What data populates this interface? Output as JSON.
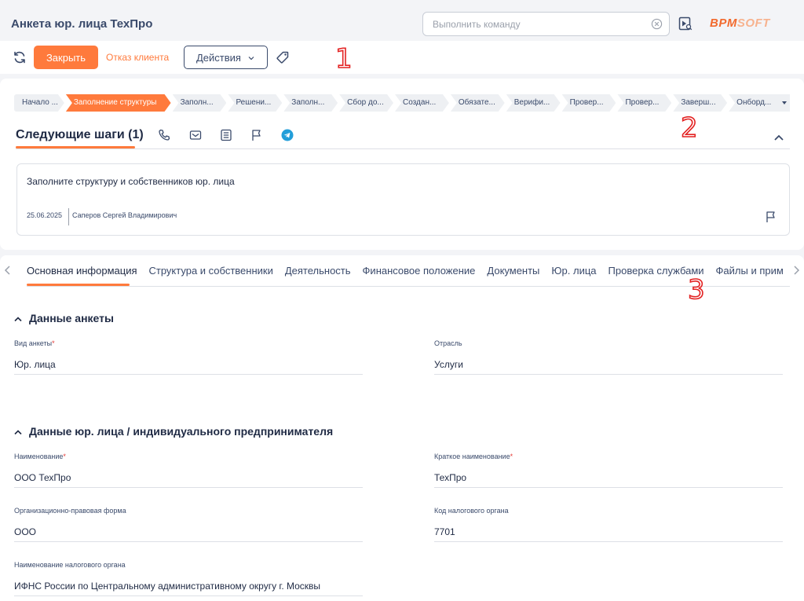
{
  "header": {
    "title": "Анкета юр. лица ТехПро",
    "command_placeholder": "Выполнить команду",
    "logo_part1": "ВРМ",
    "logo_part2": "SOFT"
  },
  "toolbar": {
    "close_label": "Закрыть",
    "reject_label": "Отказ клиента",
    "actions_label": "Действия"
  },
  "markers": [
    "1",
    "2",
    "3"
  ],
  "stages": [
    {
      "label": "Начало ...",
      "state": "done"
    },
    {
      "label": "Заполнение структуры",
      "state": "active"
    },
    {
      "label": "Заполн...",
      "state": "todo"
    },
    {
      "label": "Решени...",
      "state": "todo"
    },
    {
      "label": "Заполн...",
      "state": "todo"
    },
    {
      "label": "Сбор до...",
      "state": "todo"
    },
    {
      "label": "Создан...",
      "state": "todo"
    },
    {
      "label": "Обязате...",
      "state": "todo"
    },
    {
      "label": "Верифи...",
      "state": "todo"
    },
    {
      "label": "Провер...",
      "state": "todo"
    },
    {
      "label": "Провер...",
      "state": "todo"
    },
    {
      "label": "Заверш...",
      "state": "todo"
    },
    {
      "label": "Онборд...",
      "state": "todo"
    }
  ],
  "next_steps": {
    "title": "Следующие шаги (1)",
    "icons": [
      "phone-icon",
      "email-icon",
      "note-icon",
      "flag-icon",
      "telegram-icon"
    ],
    "task": {
      "text": "Заполните структуру и собственников юр. лица",
      "date": "25.06.2025",
      "owner": "Саперов Сергей Владимирович"
    }
  },
  "tabs": [
    "Основная информация",
    "Структура и собственники",
    "Деятельность",
    "Финансовое положение",
    "Документы",
    "Юр. лица",
    "Проверка службами",
    "Файлы и примечания"
  ],
  "sections": {
    "questionnaire": {
      "title": "Данные анкеты",
      "form_type_label": "Вид анкеты",
      "form_type_value": "Юр. лица",
      "industry_label": "Отрасль",
      "industry_value": "Услуги"
    },
    "entity": {
      "title": "Данные юр. лица / индивидуального предпринимателя",
      "name_label": "Наименование",
      "name_value": "ООО ТехПро",
      "short_name_label": "Краткое наименование",
      "short_name_value": "ТехПро",
      "legal_form_label": "Организационно-правовая форма",
      "legal_form_value": "ООО",
      "tax_code_label": "Код налогового органа",
      "tax_code_value": "7701",
      "tax_name_label": "Наименование налогового органа",
      "tax_name_value": "ИФНС России по Центральному административному округу г. Москвы"
    }
  },
  "required_mark": "*",
  "colors": {
    "accent": "#ff7a3c",
    "text": "#1f2a44",
    "muted": "#3a4a6b",
    "required": "#e53935",
    "telegram": "#229ed9"
  }
}
